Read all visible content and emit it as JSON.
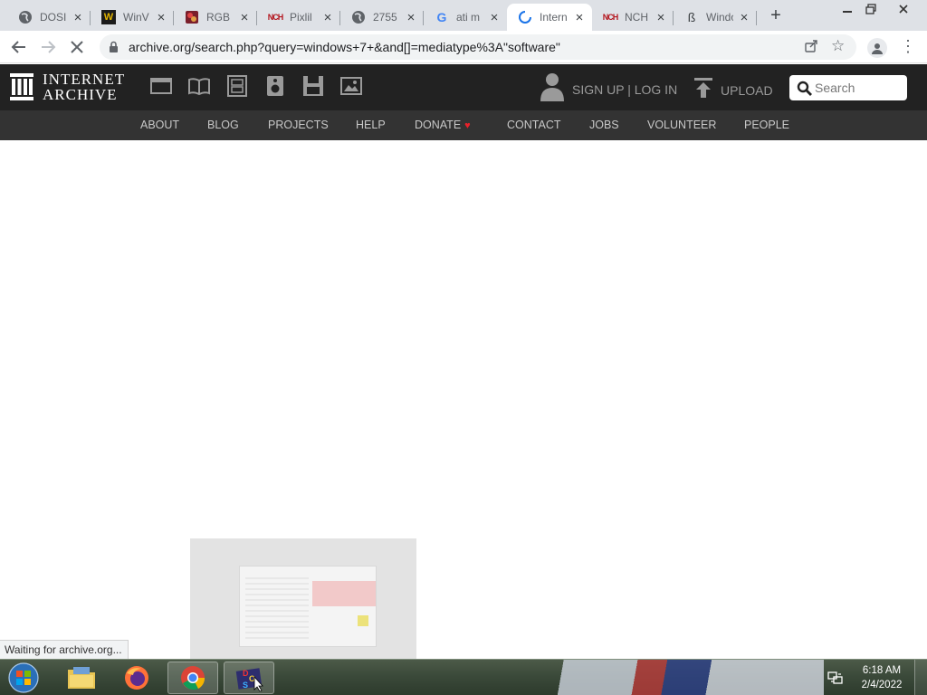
{
  "browser": {
    "tabs": [
      {
        "title": "DOSI",
        "favicon": "globe-icon",
        "active": false
      },
      {
        "title": "WinV",
        "favicon": "winworld-icon",
        "active": false
      },
      {
        "title": "RGB",
        "favicon": "rgb-app-icon",
        "active": false
      },
      {
        "title": "Pixlil",
        "favicon": "nch-icon",
        "active": false
      },
      {
        "title": "2755",
        "favicon": "globe-icon",
        "active": false
      },
      {
        "title": "ati m",
        "favicon": "google-icon",
        "active": false
      },
      {
        "title": "Intern",
        "favicon": "loading-spinner-icon",
        "active": true
      },
      {
        "title": "NCH",
        "favicon": "nch-icon",
        "active": false
      },
      {
        "title": "Windo",
        "favicon": "beta-icon",
        "active": false
      }
    ],
    "new_tab_symbol": "+",
    "url": "archive.org/search.php?query=windows+7+&and[]=mediatype%3A\"software\"",
    "status_text": "Waiting for archive.org..."
  },
  "archive": {
    "brand_line1": "INTERNET",
    "brand_line2": "ARCHIVE",
    "media_icons": [
      "web-icon",
      "texts-icon",
      "video-icon",
      "audio-icon",
      "software-icon",
      "images-icon"
    ],
    "signup_login": "SIGN UP | LOG IN",
    "upload": "UPLOAD",
    "search_placeholder": "Search",
    "nav": [
      {
        "label": "ABOUT"
      },
      {
        "label": "BLOG"
      },
      {
        "label": "PROJECTS"
      },
      {
        "label": "HELP"
      },
      {
        "label": "DONATE"
      },
      {
        "label": "CONTACT"
      },
      {
        "label": "JOBS"
      },
      {
        "label": "VOLUNTEER"
      },
      {
        "label": "PEOPLE"
      }
    ]
  },
  "taskbar": {
    "apps": [
      "windows-explorer-icon",
      "firefox-icon",
      "chrome-icon",
      "dosbox-icon"
    ],
    "time": "6:18 AM",
    "date": "2/4/2022"
  },
  "colors": {
    "archive_header": "#222222",
    "archive_nav": "#333333",
    "donate_heart": "#e8212a",
    "tabstrip": "#dee1e6"
  }
}
